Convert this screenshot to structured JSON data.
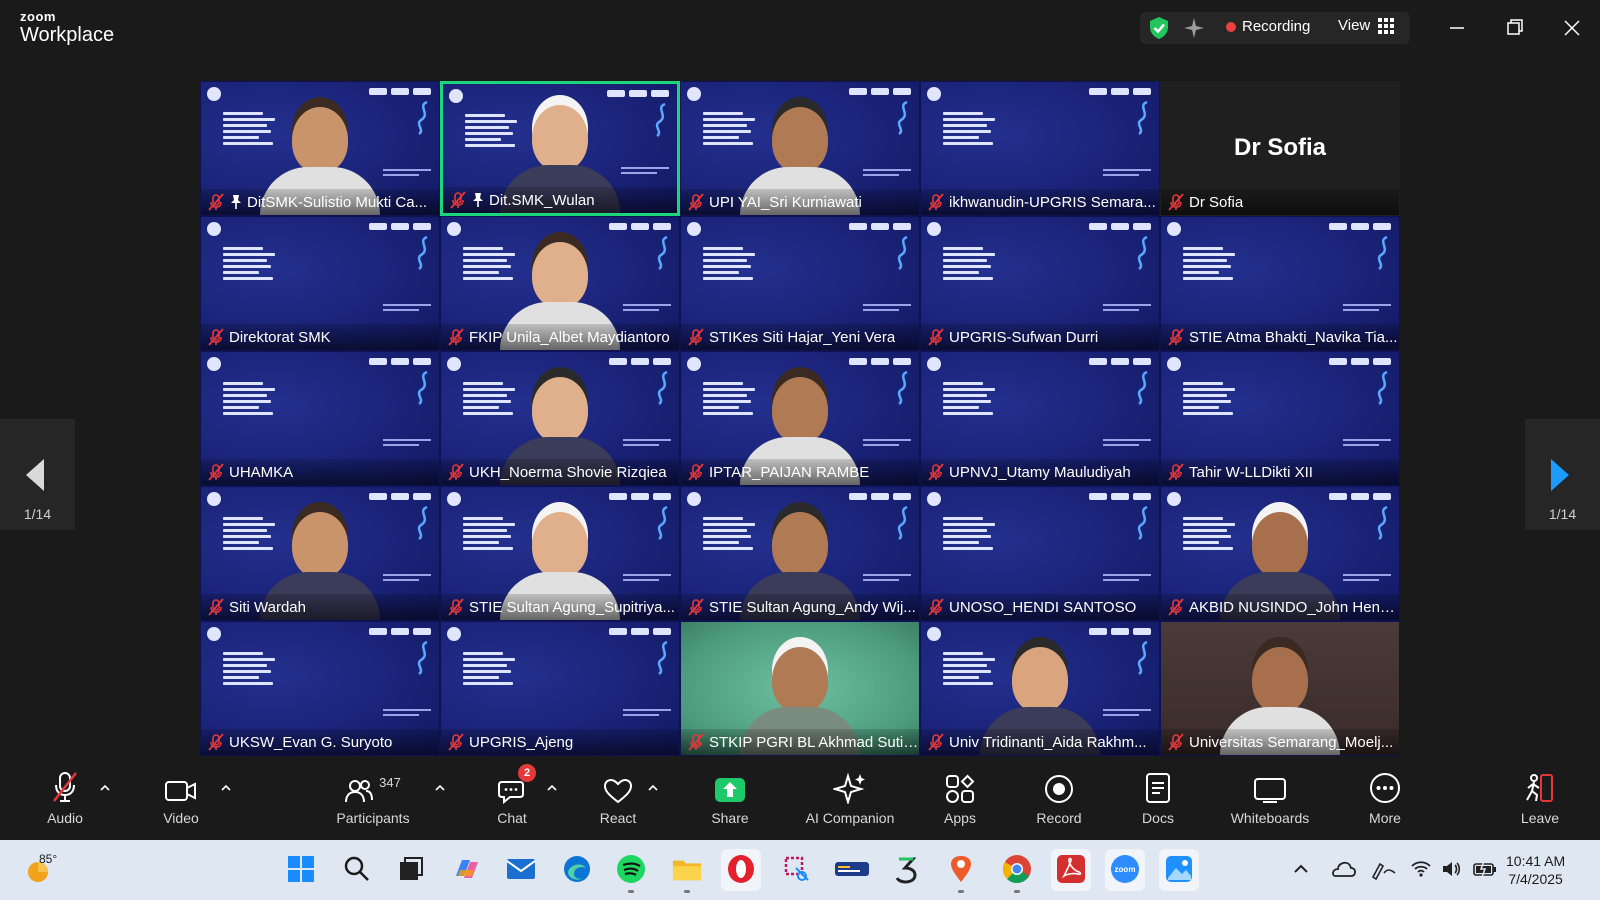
{
  "app": {
    "brand_top": "zoom",
    "brand_bottom": "Workplace"
  },
  "titlebar": {
    "recording_label": "Recording",
    "view_label": "View"
  },
  "pagination": {
    "left": "1/14",
    "right": "1/14"
  },
  "participants": [
    {
      "name": "DitSMK-Sulistio Mukti Ca...",
      "style": "slide-person",
      "pin": true
    },
    {
      "name": "Dit.SMK_Wulan",
      "style": "slide-person",
      "pin": true,
      "active": true
    },
    {
      "name": "UPI YAI_Sri Kurniawati",
      "style": "slide-person"
    },
    {
      "name": "ikhwanudin-UPGRIS Semara...",
      "style": "slide"
    },
    {
      "name": "Dr Sofia",
      "style": "dark",
      "big_name": "Dr Sofia"
    },
    {
      "name": "Direktorat SMK",
      "style": "slide"
    },
    {
      "name": "FKIP Unila_Albet Maydiantoro",
      "style": "slide-person"
    },
    {
      "name": "STIKes Siti Hajar_Yeni Vera",
      "style": "slide"
    },
    {
      "name": "UPGRIS-Sufwan Durri",
      "style": "slide"
    },
    {
      "name": "STIE Atma Bhakti_Navika Tia...",
      "style": "slide"
    },
    {
      "name": "UHAMKA",
      "style": "slide"
    },
    {
      "name": "UKH_Noerma Shovie Rizqiea",
      "style": "slide-person"
    },
    {
      "name": "IPTAR_PAIJAN RAMBE",
      "style": "slide-person"
    },
    {
      "name": "UPNVJ_Utamy Mauludiyah",
      "style": "slide"
    },
    {
      "name": "Tahir W-LLDikti XII",
      "style": "slide"
    },
    {
      "name": "Siti Wardah",
      "style": "slide-person"
    },
    {
      "name": "STIE Sultan Agung_Supitriya...",
      "style": "slide-person"
    },
    {
      "name": "STIE Sultan Agung_Andy Wij...",
      "style": "slide-person"
    },
    {
      "name": "UNOSO_HENDI SANTOSO",
      "style": "slide"
    },
    {
      "name": "AKBID NUSINDO_John Hend...",
      "style": "slide-person"
    },
    {
      "name": "UKSW_Evan G. Suryoto",
      "style": "slide"
    },
    {
      "name": "UPGRIS_Ajeng",
      "style": "slide"
    },
    {
      "name": "STKIP PGRI BL Akhmad Sutiy...",
      "style": "green"
    },
    {
      "name": "Univ Tridinanti_Aida Rakhm...",
      "style": "slide-person"
    },
    {
      "name": "Universitas Semarang_Moelj...",
      "style": "warm"
    }
  ],
  "toolbar": {
    "audio": "Audio",
    "video": "Video",
    "participants": "Participants",
    "participants_count": "347",
    "chat": "Chat",
    "chat_badge": "2",
    "react": "React",
    "share": "Share",
    "ai_companion": "AI Companion",
    "apps": "Apps",
    "record": "Record",
    "docs": "Docs",
    "whiteboards": "Whiteboards",
    "more": "More",
    "leave": "Leave"
  },
  "taskbar": {
    "temperature": "85°",
    "time": "10:41 AM",
    "date": "7/4/2025",
    "apps": [
      "windows-start",
      "search",
      "task-view",
      "copilot",
      "mail",
      "edge",
      "spotify",
      "file-explorer",
      "opera",
      "snipping-tool",
      "kampus-merdeka",
      "app-3",
      "location-app",
      "chrome",
      "acrobat",
      "zoom",
      "photos"
    ]
  },
  "colors": {
    "active_border": "#1ed67a",
    "mute_red": "#e5383b",
    "share_green": "#1ec96a",
    "tile_blue": "#1a2378"
  }
}
